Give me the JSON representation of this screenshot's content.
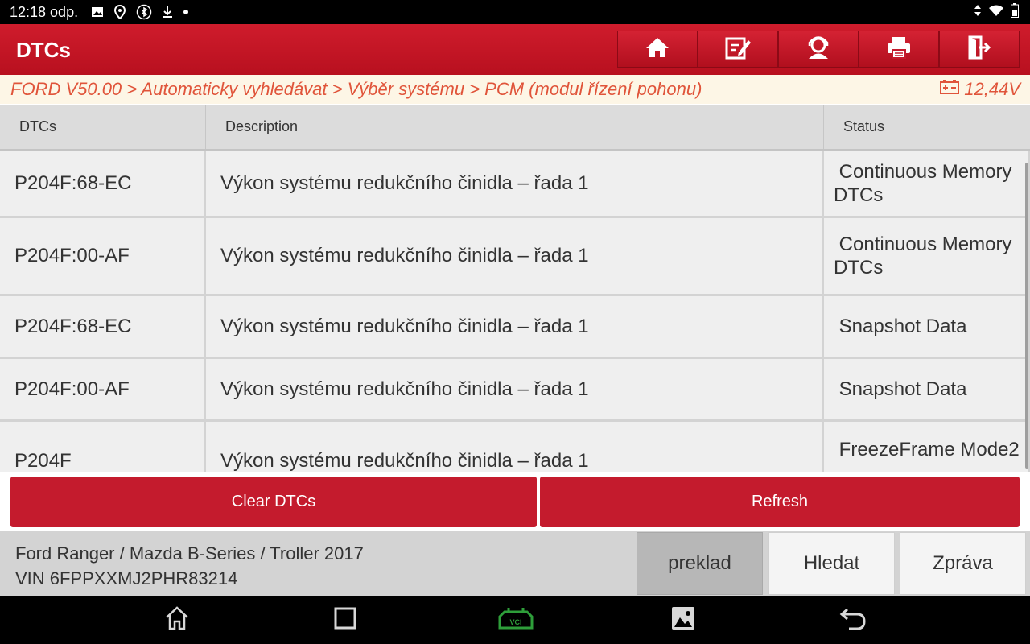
{
  "status_bar": {
    "time": "12:18 odp.",
    "icons": [
      "image-icon",
      "location-icon",
      "bluetooth-icon",
      "download-icon",
      "dot-icon"
    ],
    "right_icons": [
      "data-arrows-icon",
      "wifi-icon",
      "battery-icon"
    ]
  },
  "header": {
    "title": "DTCs",
    "toolbar": [
      "home-icon",
      "edit-report-icon",
      "support-icon",
      "print-icon",
      "exit-icon"
    ]
  },
  "breadcrumb": {
    "path": "FORD V50.00 > Automaticky vyhledávat > Výběr systému > PCM (modul řízení pohonu)",
    "voltage": "12,44V"
  },
  "table": {
    "columns": [
      "DTCs",
      "Description",
      "Status"
    ],
    "rows": [
      {
        "code": "P204F:68-EC",
        "description": "Výkon systému redukčního činidla – řada 1",
        "status": " Continuous Memory DTCs"
      },
      {
        "code": "P204F:00-AF",
        "description": "Výkon systému redukčního činidla – řada 1",
        "status": " Continuous Memory DTCs"
      },
      {
        "code": "P204F:68-EC",
        "description": "Výkon systému redukčního činidla – řada 1",
        "status": " Snapshot Data"
      },
      {
        "code": "P204F:00-AF",
        "description": "Výkon systému redukčního činidla – řada 1",
        "status": " Snapshot Data"
      },
      {
        "code": "P204F",
        "description": "Výkon systému redukčního činidla – řada 1",
        "status": " FreezeFrame Mode2"
      }
    ]
  },
  "actions": {
    "clear_label": "Clear DTCs",
    "refresh_label": "Refresh"
  },
  "footer": {
    "vehicle": "Ford Ranger / Mazda B-Series / Troller 2017",
    "vin": "VIN 6FPPXXMJ2PHR83214",
    "buttons": {
      "translate": "preklad",
      "search": "Hledat",
      "report": "Zpráva"
    }
  },
  "nav": [
    "home-icon",
    "recents-icon",
    "vci-icon",
    "gallery-icon",
    "back-icon"
  ],
  "colors": {
    "accent": "#c41b2d",
    "breadcrumb_text": "#e0543a",
    "vci_green": "#2e9e3a"
  }
}
